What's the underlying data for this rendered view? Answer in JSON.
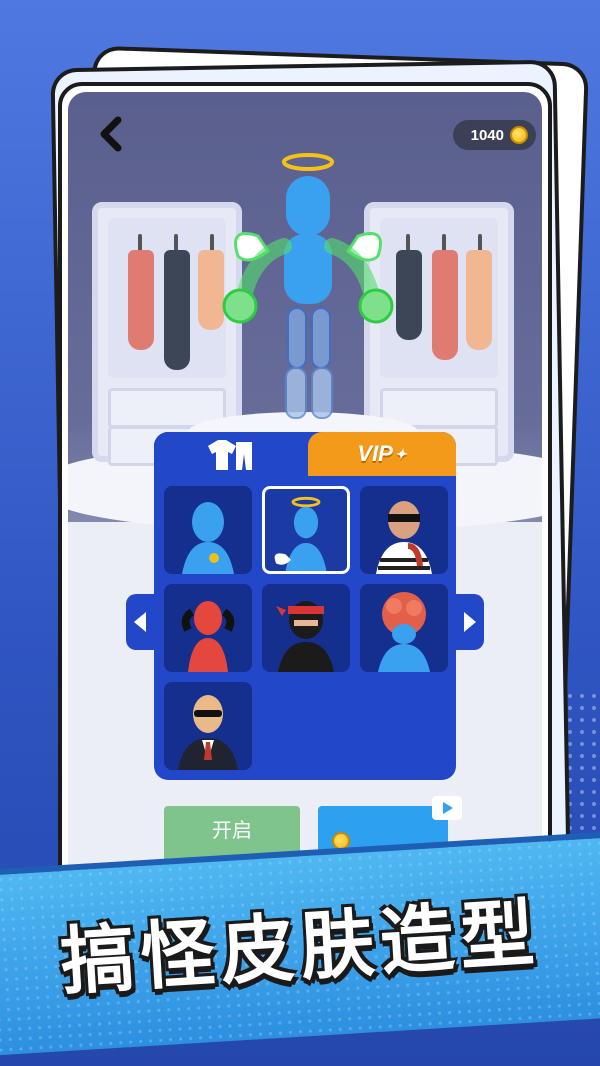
{
  "header": {
    "coins": "1040"
  },
  "tabs": {
    "clothes_icon": "clothes-icon",
    "vip_label": "VIP"
  },
  "skins": [
    {
      "name": "blue-runner",
      "selected": false
    },
    {
      "name": "angel",
      "selected": true
    },
    {
      "name": "thief",
      "selected": false
    },
    {
      "name": "red-devil",
      "selected": false
    },
    {
      "name": "ninja",
      "selected": false
    },
    {
      "name": "brain-monster",
      "selected": false
    },
    {
      "name": "agent",
      "selected": false
    }
  ],
  "buttons": {
    "open_label": "开启"
  },
  "slogan": "搞怪皮肤造型",
  "colors": {
    "panel": "#2247c8",
    "vip_tab": "#f39a1a",
    "open_button": "#7fc48c",
    "ad_button": "#2da0f0",
    "banner": "#3aa6ee"
  }
}
